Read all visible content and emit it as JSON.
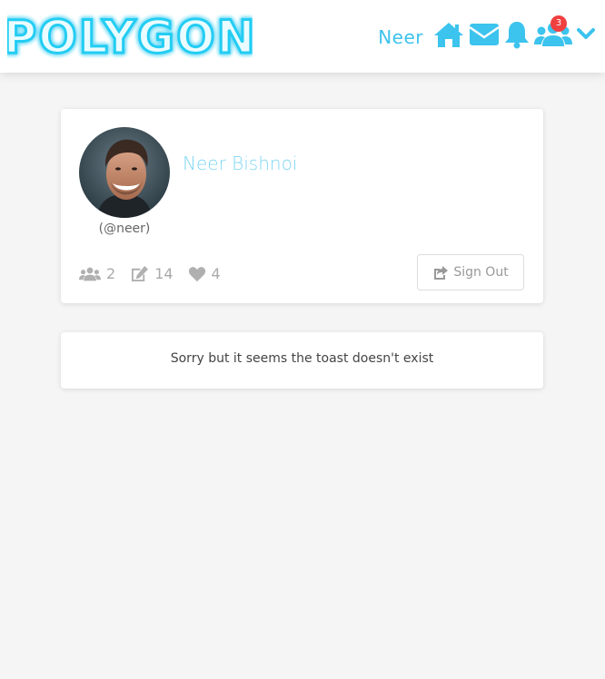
{
  "brand": {
    "logo_text": "POLYGON"
  },
  "navbar": {
    "username": "Neer",
    "icons": [
      "home-icon",
      "envelope-icon",
      "bell-icon",
      "users-icon",
      "chevron-down-icon"
    ],
    "friend_requests_badge": "3",
    "accent_color": "#3cc3ee"
  },
  "profile": {
    "full_name": "Neer Bishnoi",
    "handle": "(@neer)",
    "stats": {
      "friends": "2",
      "posts": "14",
      "likes": "4"
    },
    "sign_out_label": "Sign Out"
  },
  "toast": {
    "message": "Sorry but it seems the toast doesn't exist"
  }
}
